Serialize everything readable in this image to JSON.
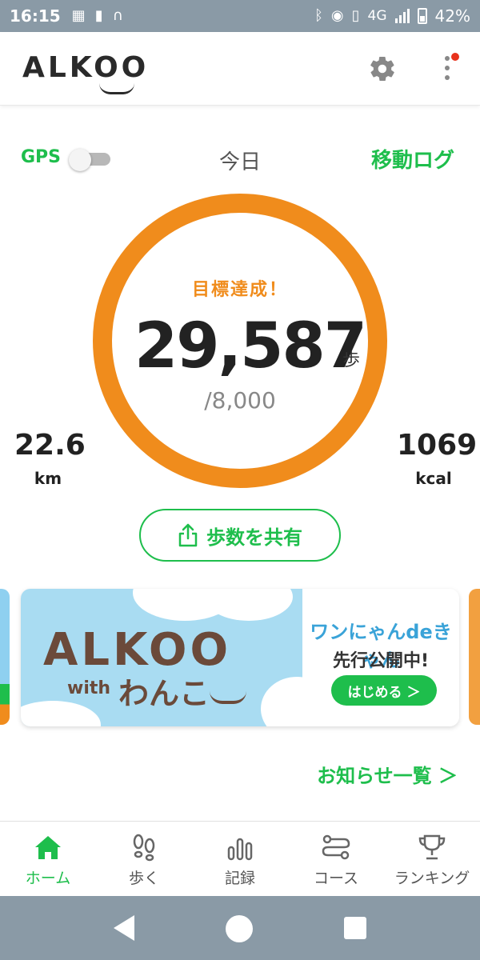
{
  "status_bar": {
    "time": "16:15",
    "battery": "42%",
    "network": "4G",
    "icons": [
      "cast-icon",
      "alert-icon",
      "headset-icon",
      "bluetooth-icon",
      "location-icon",
      "vibrate-icon",
      "signal-icon",
      "battery-icon"
    ]
  },
  "header": {
    "logo": "ALKOO",
    "icons": [
      "gear-icon",
      "more-menu-icon"
    ]
  },
  "today": {
    "gps_label": "GPS",
    "gps_enabled": false,
    "day_label": "今日",
    "move_log": "移動ログ"
  },
  "steps": {
    "status": "目標達成！",
    "count": "29,587",
    "unit": "歩",
    "goal": "/8,000",
    "distance_value": "22.6",
    "distance_unit": "km",
    "calories_value": "1069",
    "calories_unit": "kcal",
    "share_label": "歩数を共有"
  },
  "banner": {
    "logo": "ALKOO",
    "with": "with",
    "wanko": "わんこ",
    "title": "ワンにゃんdeきゃん",
    "subtitle": "先行公開中!",
    "button": "はじめる ＞"
  },
  "notices_link": "お知らせ一覧 ＞",
  "nav": {
    "items": [
      {
        "label": "ホーム",
        "icon": "home-icon",
        "active": true
      },
      {
        "label": "歩く",
        "icon": "footprints-icon",
        "active": false
      },
      {
        "label": "記録",
        "icon": "bars-icon",
        "active": false
      },
      {
        "label": "コース",
        "icon": "route-icon",
        "active": false
      },
      {
        "label": "ランキング",
        "icon": "trophy-icon",
        "active": false
      }
    ]
  },
  "colors": {
    "accent_green": "#1ebe4c",
    "ring_orange": "#f08c1c",
    "system_bar": "#8a9aa6"
  }
}
